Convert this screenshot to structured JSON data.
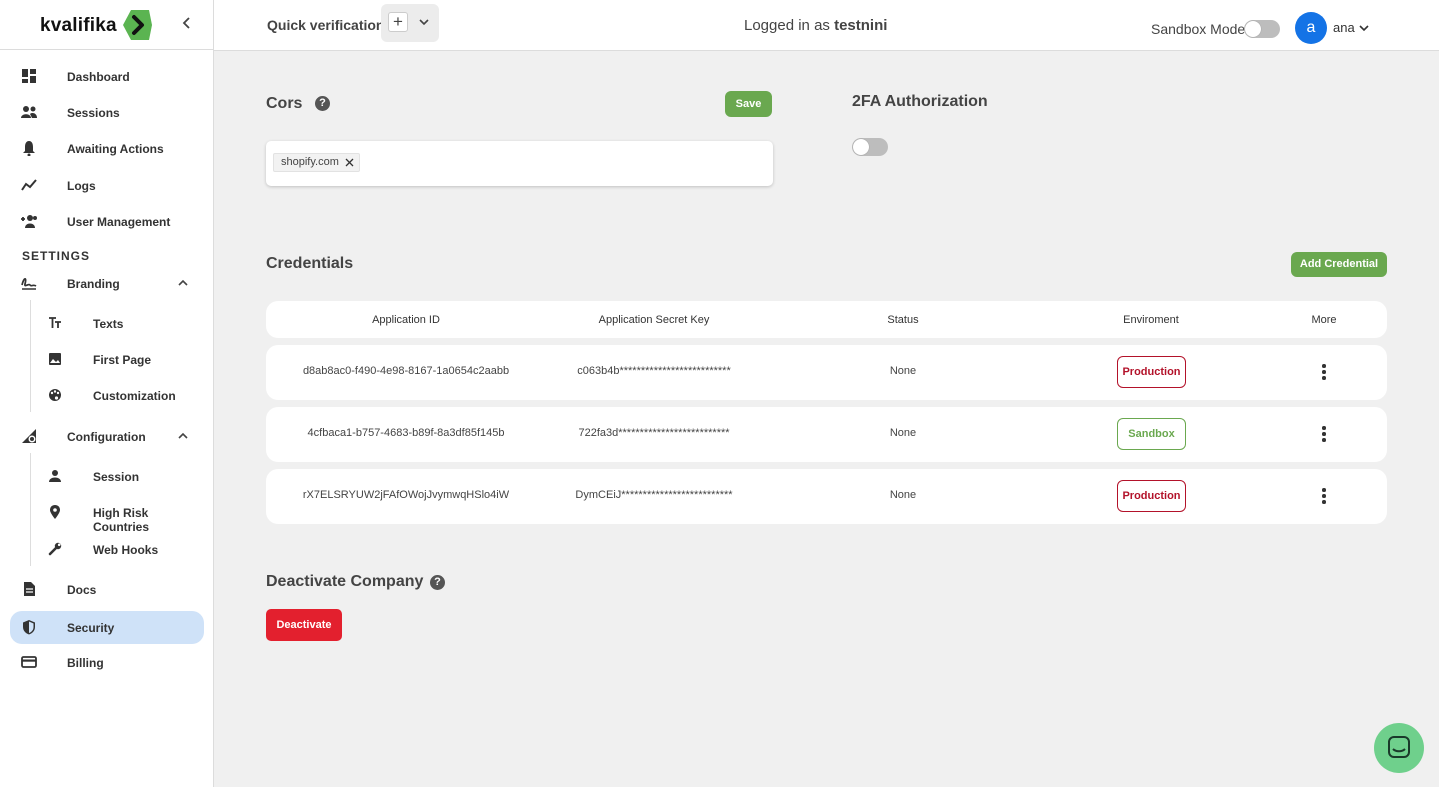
{
  "brand": {
    "name": "kvalifika",
    "accent": "#6aa84f",
    "logo_color": "#5bb451"
  },
  "sidebar": {
    "items": [
      {
        "label": "Dashboard",
        "icon": "dashboard-icon"
      },
      {
        "label": "Sessions",
        "icon": "people-icon"
      },
      {
        "label": "Awaiting Actions",
        "icon": "bell-icon"
      },
      {
        "label": "Logs",
        "icon": "trend-icon"
      },
      {
        "label": "User Management",
        "icon": "add-users-icon"
      }
    ],
    "settings_heading": "SETTINGS",
    "branding": {
      "label": "Branding",
      "children": [
        {
          "label": "Texts",
          "icon": "text-format-icon"
        },
        {
          "label": "First Page",
          "icon": "image-icon"
        },
        {
          "label": "Customization",
          "icon": "palette-icon"
        }
      ]
    },
    "configuration": {
      "label": "Configuration",
      "children": [
        {
          "label": "Session",
          "icon": "person-icon"
        },
        {
          "label": "High Risk Countries",
          "icon": "location-pin-icon"
        },
        {
          "label": "Web Hooks",
          "icon": "wrench-icon"
        }
      ]
    },
    "docs": "Docs",
    "security": "Security",
    "billing": "Billing"
  },
  "topbar": {
    "quick_verification": "Quick verification",
    "plus": "+",
    "logged_prefix": "Logged in as",
    "logged_user": "testnini",
    "sandbox_label": "Sandbox Mode",
    "sandbox_on": false,
    "avatar_letter": "a",
    "user_name": "ana"
  },
  "cors": {
    "title": "Cors",
    "help": "?",
    "save_label": "Save",
    "domains": [
      "shopify.com"
    ]
  },
  "twofa": {
    "title": "2FA Authorization",
    "enabled": false
  },
  "credentials": {
    "title": "Credentials",
    "add_label": "Add Credential",
    "columns": [
      "Application ID",
      "Application Secret Key",
      "Status",
      "Enviroment",
      "More"
    ],
    "rows": [
      {
        "app_id": "d8ab8ac0-f490-4e98-8167-1a0654c2aabb",
        "secret": "c063b4b**************************",
        "status": "None",
        "env": "Production"
      },
      {
        "app_id": "4cfbaca1-b757-4683-b89f-8a3df85f145b",
        "secret": "722fa3d**************************",
        "status": "None",
        "env": "Sandbox"
      },
      {
        "app_id": "rX7ELSRYUW2jFAfOWojJvymwqHSlo4iW",
        "secret": "DymCEiJ**************************",
        "status": "None",
        "env": "Production"
      }
    ]
  },
  "deactivate": {
    "title": "Deactivate Company",
    "help": "?",
    "button_label": "Deactivate",
    "color": "#e3202e"
  }
}
